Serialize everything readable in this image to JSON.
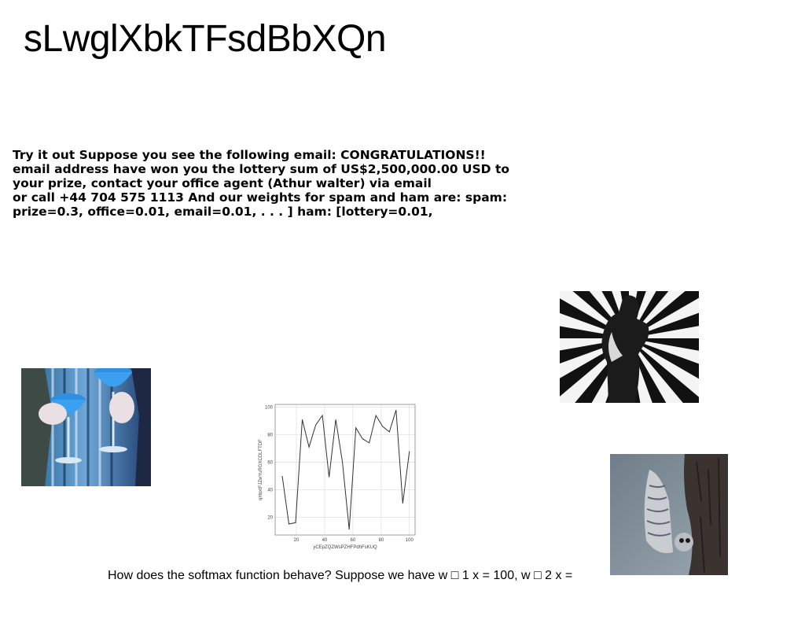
{
  "title": "sLwglXbkTFsdBbXQn",
  "paragraph_lines": [
    "Try it out Suppose you see the following email: CONGRATULATIONS!!",
    "email address have won you the lottery sum of US$2,500,000.00 USD to",
    "your prize, contact your office agent (Athur walter) via email",
    "or call +44 704 575 1113 And our weights for spam and ham are: spam:",
    "prize=0.3, office=0.01, email=0.01, . . . ] ham: [lottery=0.01,"
  ],
  "caption": "How does the softmax function behave? Suppose we have w □ 1 x = 100, w □ 2 x =",
  "images": {
    "drinks": "photo-blue-cocktails",
    "dancer": "photo-striped-dancer",
    "owl": "photo-owl-on-tree"
  },
  "chart_data": {
    "type": "line",
    "xlabel": "yCEpZQZWsPZHFPdhFsKUQ",
    "ylabel": "qHnxtFJZwYuRGXCDLFTDF",
    "x": [
      10,
      14,
      18,
      22,
      26,
      30,
      34,
      38,
      42,
      46,
      50,
      54,
      58,
      62,
      66,
      70,
      74,
      78,
      82,
      86,
      90,
      94,
      98,
      100
    ],
    "y": [
      50,
      15,
      16,
      91,
      71,
      87,
      94,
      49,
      91,
      60,
      11,
      85,
      77,
      74,
      94,
      86,
      82,
      98,
      30,
      68
    ],
    "xticks": [
      20,
      40,
      60,
      80,
      100
    ],
    "yticks": [
      20,
      40,
      60,
      80,
      100
    ],
    "xlim": [
      5,
      104
    ],
    "ylim": [
      7,
      102
    ],
    "grid": true,
    "line_color": "#333333"
  }
}
